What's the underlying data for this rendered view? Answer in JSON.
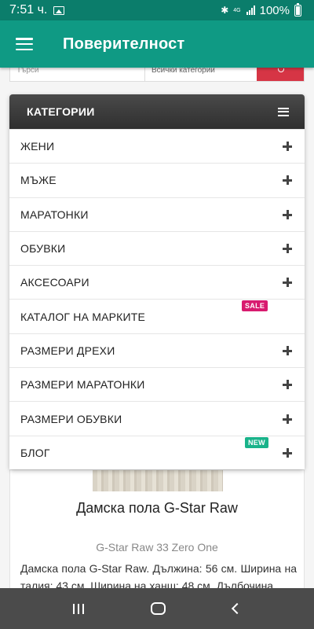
{
  "status_bar": {
    "time": "7:51 ч.",
    "network": "4G",
    "battery": "100%"
  },
  "app_bar": {
    "title": "Поверителност"
  },
  "search": {
    "input_placeholder": "Търси",
    "category_select": "Всички категории"
  },
  "categories": {
    "title": "КАТЕГОРИИ",
    "items": [
      {
        "label": "ЖЕНИ"
      },
      {
        "label": "МЪЖЕ"
      },
      {
        "label": "МАРАТОНКИ"
      },
      {
        "label": "ОБУВКИ"
      },
      {
        "label": "АКСЕСОАРИ"
      },
      {
        "label": "КАТАЛОГ НА МАРКИТЕ",
        "badge": "SALE"
      },
      {
        "label": "РАЗМЕРИ ДРЕХИ"
      },
      {
        "label": "РАЗМЕРИ МАРАТОНКИ"
      },
      {
        "label": "РАЗМЕРИ ОБУВКИ"
      },
      {
        "label": "БЛОГ",
        "badge": "NEW"
      }
    ]
  },
  "product": {
    "name": "Дамска пола G-Star Raw",
    "brand_model": "G-Star Raw 33 Zero One",
    "description": "Дамска пола G-Star Raw. Дължина: 56 см. Ширина на талия: 43 см. Ширина на ханш: 48 см. Дълбочина"
  },
  "colors": {
    "status_bar": "#0b7d6b",
    "app_bar": "#0f9a84",
    "sale_badge": "#d81b6f",
    "new_badge": "#19b38a",
    "search_button": "#d63545"
  },
  "icons": {
    "menu": "hamburger-icon",
    "expand": "plus-icon",
    "search": "search-icon"
  }
}
